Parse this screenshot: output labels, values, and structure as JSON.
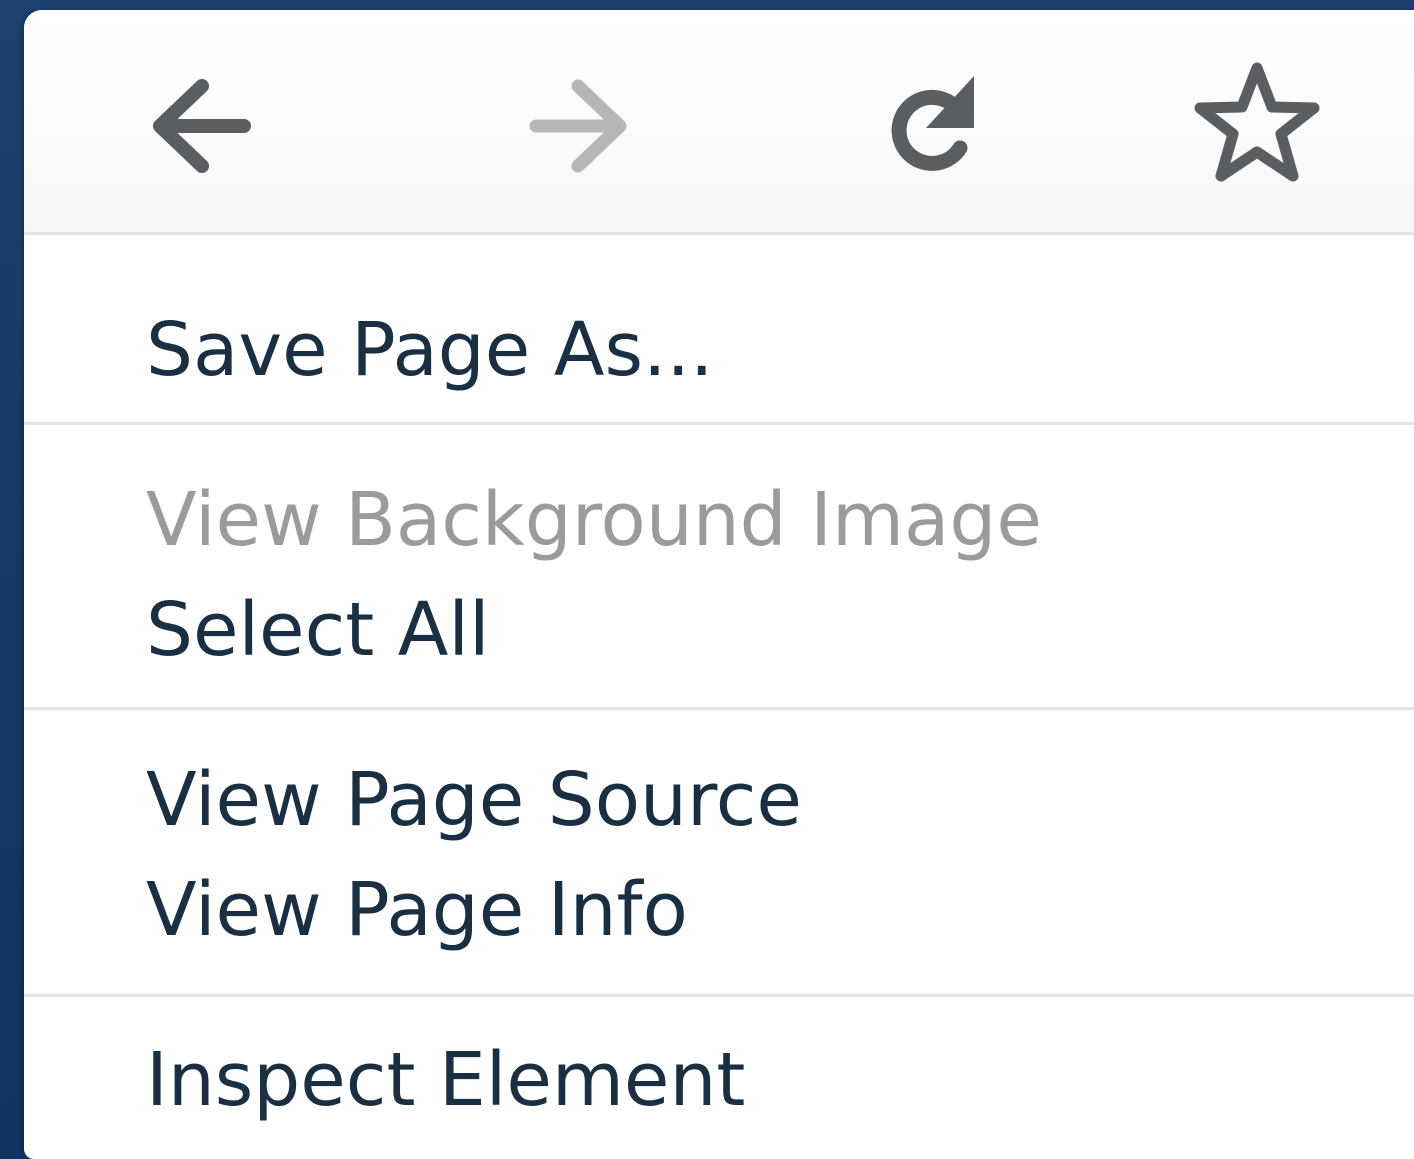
{
  "nav_buttons": [
    {
      "icon": "back-arrow-icon",
      "enabled": true
    },
    {
      "icon": "forward-arrow-icon",
      "enabled": false
    },
    {
      "icon": "reload-icon",
      "enabled": true
    },
    {
      "icon": "star-bookmark-icon",
      "enabled": true
    }
  ],
  "menu": {
    "save_page_as": "Save Page As...",
    "view_background_image": "View Background Image",
    "select_all": "Select All",
    "view_page_source": "View Page Source",
    "view_page_info": "View Page Info",
    "inspect_element": "Inspect Element"
  },
  "colors": {
    "text": "#1a2f42",
    "disabled_text": "#9b9b9b",
    "icon": "#5a5d62",
    "icon_disabled": "#b4b6b8",
    "separator": "#e4e4e4",
    "desktop_background": "#163a66"
  }
}
